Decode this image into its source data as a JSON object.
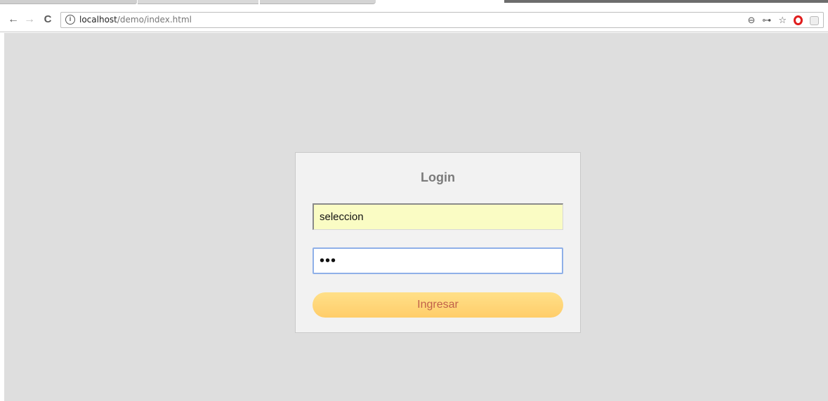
{
  "browser": {
    "url_host": "localhost",
    "url_path": "/demo/index.html",
    "nav": {
      "back_glyph": "←",
      "forward_glyph": "→",
      "reload_glyph": "C"
    },
    "omnibox_icons": [
      "zoom-out-icon",
      "key-icon",
      "star-icon",
      "opera-icon",
      "extension-icon"
    ]
  },
  "login": {
    "title": "Login",
    "username_value": "seleccion",
    "password_value": "•••",
    "submit_label": "Ingresar"
  },
  "colors": {
    "page_bg": "#dedede",
    "panel_bg": "#f2f2f2",
    "autofill_bg": "#fafcc4",
    "focus_border": "#8fb0e8",
    "button_gradient_top": "#ffe089",
    "button_gradient_bottom": "#ffcd6a",
    "button_text": "#c0614a",
    "title_text": "#7a7a7a"
  }
}
